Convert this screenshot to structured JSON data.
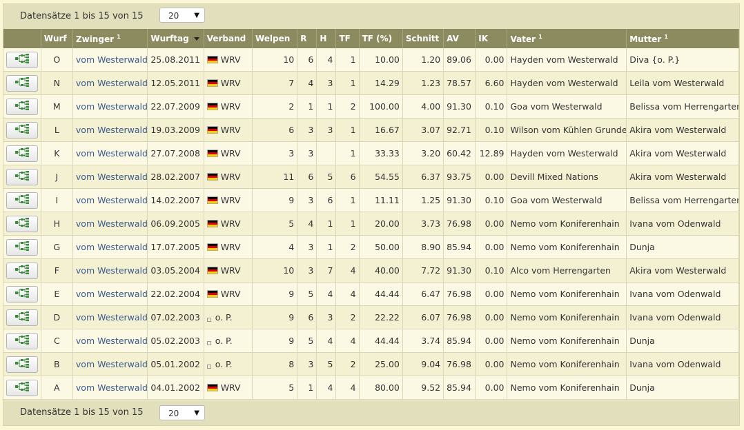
{
  "pager": {
    "summary": "Datensätze 1 bis 15 von 15",
    "page_size": "20"
  },
  "columns": [
    "Wurf",
    "Zwinger",
    "Wurftag",
    "Verband",
    "Welpen",
    "R",
    "H",
    "TF",
    "TF (%)",
    "Schnitt",
    "AV",
    "IK",
    "Vater",
    "Mutter"
  ],
  "column_footnote": "1",
  "icons": {
    "pedigree": "pedigree-tree-icon",
    "flag_de": "german-flag-icon"
  },
  "rows": [
    {
      "wurf": "O",
      "zwinger": "vom Westerwald",
      "wurftag": "25.08.2011",
      "verband": "WRV",
      "flag": true,
      "welpen": "10",
      "r": "6",
      "h": "4",
      "tf": "1",
      "tfp": "10.00",
      "schnitt": "1.20",
      "av": "89.06",
      "ik": "0.00",
      "vater": "Hayden vom Westerwald",
      "mutter": "Diva {o. P.}"
    },
    {
      "wurf": "N",
      "zwinger": "vom Westerwald",
      "wurftag": "12.05.2011",
      "verband": "WRV",
      "flag": true,
      "welpen": "7",
      "r": "4",
      "h": "3",
      "tf": "1",
      "tfp": "14.29",
      "schnitt": "1.23",
      "av": "78.57",
      "ik": "6.60",
      "vater": "Hayden vom Westerwald",
      "mutter": "Leila vom Westerwald"
    },
    {
      "wurf": "M",
      "zwinger": "vom Westerwald",
      "wurftag": "22.07.2009",
      "verband": "WRV",
      "flag": true,
      "welpen": "2",
      "r": "1",
      "h": "1",
      "tf": "2",
      "tfp": "100.00",
      "schnitt": "4.00",
      "av": "91.30",
      "ik": "0.10",
      "vater": "Goa vom Westerwald",
      "mutter": "Belissa vom Herrengarten"
    },
    {
      "wurf": "L",
      "zwinger": "vom Westerwald",
      "wurftag": "19.03.2009",
      "verband": "WRV",
      "flag": true,
      "welpen": "6",
      "r": "3",
      "h": "3",
      "tf": "1",
      "tfp": "16.67",
      "schnitt": "3.07",
      "av": "92.71",
      "ik": "0.10",
      "vater": "Wilson vom Kühlen Grunde",
      "mutter": "Akira vom Westerwald"
    },
    {
      "wurf": "K",
      "zwinger": "vom Westerwald",
      "wurftag": "27.07.2008",
      "verband": "WRV",
      "flag": true,
      "welpen": "3",
      "r": "3",
      "h": "",
      "tf": "1",
      "tfp": "33.33",
      "schnitt": "3.20",
      "av": "60.42",
      "ik": "12.89",
      "vater": "Hayden vom Westerwald",
      "mutter": "Akira vom Westerwald"
    },
    {
      "wurf": "J",
      "zwinger": "vom Westerwald",
      "wurftag": "28.02.2007",
      "verband": "WRV",
      "flag": true,
      "welpen": "11",
      "r": "6",
      "h": "5",
      "tf": "6",
      "tfp": "54.55",
      "schnitt": "6.37",
      "av": "93.75",
      "ik": "0.00",
      "vater": "Devill Mixed Nations",
      "mutter": "Akira vom Westerwald"
    },
    {
      "wurf": "I",
      "zwinger": "vom Westerwald",
      "wurftag": "14.02.2007",
      "verband": "WRV",
      "flag": true,
      "welpen": "9",
      "r": "3",
      "h": "6",
      "tf": "1",
      "tfp": "11.11",
      "schnitt": "1.25",
      "av": "91.30",
      "ik": "0.10",
      "vater": "Goa vom Westerwald",
      "mutter": "Belissa vom Herrengarten"
    },
    {
      "wurf": "H",
      "zwinger": "vom Westerwald",
      "wurftag": "06.09.2005",
      "verband": "WRV",
      "flag": true,
      "welpen": "5",
      "r": "4",
      "h": "1",
      "tf": "1",
      "tfp": "20.00",
      "schnitt": "3.73",
      "av": "76.98",
      "ik": "0.00",
      "vater": "Nemo vom Koniferenhain",
      "mutter": "Ivana vom Odenwald"
    },
    {
      "wurf": "G",
      "zwinger": "vom Westerwald",
      "wurftag": "17.07.2005",
      "verband": "WRV",
      "flag": true,
      "welpen": "4",
      "r": "3",
      "h": "1",
      "tf": "2",
      "tfp": "50.00",
      "schnitt": "8.90",
      "av": "85.94",
      "ik": "0.00",
      "vater": "Nemo vom Koniferenhain",
      "mutter": "Dunja"
    },
    {
      "wurf": "F",
      "zwinger": "vom Westerwald",
      "wurftag": "03.05.2004",
      "verband": "WRV",
      "flag": true,
      "welpen": "10",
      "r": "3",
      "h": "7",
      "tf": "4",
      "tfp": "40.00",
      "schnitt": "7.72",
      "av": "91.30",
      "ik": "0.10",
      "vater": "Alco vom Herrengarten",
      "mutter": "Akira vom Westerwald"
    },
    {
      "wurf": "E",
      "zwinger": "vom Westerwald",
      "wurftag": "22.02.2004",
      "verband": "WRV",
      "flag": true,
      "welpen": "9",
      "r": "5",
      "h": "4",
      "tf": "4",
      "tfp": "44.44",
      "schnitt": "6.47",
      "av": "76.98",
      "ik": "0.00",
      "vater": "Nemo vom Koniferenhain",
      "mutter": "Ivana vom Odenwald"
    },
    {
      "wurf": "D",
      "zwinger": "vom Westerwald",
      "wurftag": "07.02.2003",
      "verband": "o. P.",
      "flag": false,
      "welpen": "9",
      "r": "6",
      "h": "3",
      "tf": "2",
      "tfp": "22.22",
      "schnitt": "6.07",
      "av": "76.98",
      "ik": "0.00",
      "vater": "Nemo vom Koniferenhain",
      "mutter": "Ivana vom Odenwald"
    },
    {
      "wurf": "C",
      "zwinger": "vom Westerwald",
      "wurftag": "05.02.2003",
      "verband": "o. P.",
      "flag": false,
      "welpen": "9",
      "r": "5",
      "h": "4",
      "tf": "4",
      "tfp": "44.44",
      "schnitt": "3.74",
      "av": "85.94",
      "ik": "0.00",
      "vater": "Nemo vom Koniferenhain",
      "mutter": "Dunja"
    },
    {
      "wurf": "B",
      "zwinger": "vom Westerwald",
      "wurftag": "05.01.2002",
      "verband": "o. P.",
      "flag": false,
      "welpen": "8",
      "r": "3",
      "h": "5",
      "tf": "2",
      "tfp": "25.00",
      "schnitt": "9.04",
      "av": "76.98",
      "ik": "0.00",
      "vater": "Nemo vom Koniferenhain",
      "mutter": "Ivana vom Odenwald"
    },
    {
      "wurf": "A",
      "zwinger": "vom Westerwald",
      "wurftag": "04.01.2002",
      "verband": "WRV",
      "flag": true,
      "welpen": "5",
      "r": "1",
      "h": "4",
      "tf": "4",
      "tfp": "80.00",
      "schnitt": "9.52",
      "av": "85.94",
      "ik": "0.00",
      "vater": "Nemo vom Koniferenhain",
      "mutter": "Dunja"
    }
  ]
}
